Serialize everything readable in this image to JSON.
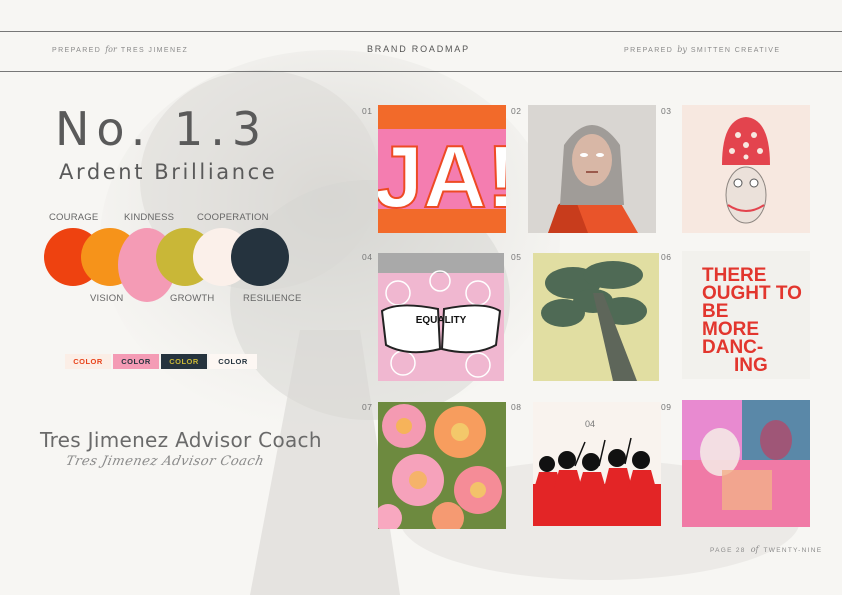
{
  "header": {
    "prepared_for_pre": "PREPARED",
    "prepared_for_word": "for",
    "prepared_for_name": "TRES JIMENEZ",
    "title": "BRAND ROADMAP",
    "prepared_by_pre": "PREPARED",
    "prepared_by_word": "by",
    "prepared_by_name": "SMITTEN CREATIVE"
  },
  "title_block": {
    "number": "No. 1.3",
    "name": "Ardent Brilliance"
  },
  "palette": {
    "top_labels": [
      "COURAGE",
      "KINDNESS",
      "COOPERATION"
    ],
    "bottom_labels": [
      "VISION",
      "GROWTH",
      "RESILIENCE"
    ],
    "swatches": [
      "#ee4210",
      "#f6931a",
      "#f49bb5",
      "#c9b737",
      "#fbf0ea",
      "#25333e"
    ]
  },
  "color_tags": [
    {
      "label": "COLOR",
      "bg": "#fbeee6",
      "fg": "#e8431a"
    },
    {
      "label": "COLOR",
      "bg": "#f49bb5",
      "fg": "#25333e"
    },
    {
      "label": "COLOR",
      "bg": "#25333e",
      "fg": "#c9b737"
    },
    {
      "label": "COLOR",
      "bg": "#fdf7f3",
      "fg": "#25333e"
    }
  ],
  "signature": {
    "print": "Tres Jimenez Advisor Coach",
    "script": "Tres Jimenez Advisor Coach"
  },
  "grid": {
    "numbers": [
      "01",
      "02",
      "03",
      "04",
      "05",
      "06",
      "07",
      "08",
      "09"
    ],
    "tile1_text": "JA!",
    "tile4_text": "EQUALITY",
    "tile6_lines": [
      "THERE",
      "OUGHT TO",
      "BE",
      "MORE",
      "DANC-",
      "ING"
    ],
    "tile8_text": "04",
    "icons": [
      "ja-poster-image",
      "woman-portrait-image",
      "owl-illustration-image",
      "equality-fists-image",
      "tree-canopy-image",
      "dancing-poster-image",
      "dahlia-flowers-image",
      "red-dancers-image",
      "pink-collage-image"
    ]
  },
  "footer": {
    "page_pre": "PAGE 28",
    "page_word": "of",
    "page_total": "TWENTY-NINE"
  }
}
